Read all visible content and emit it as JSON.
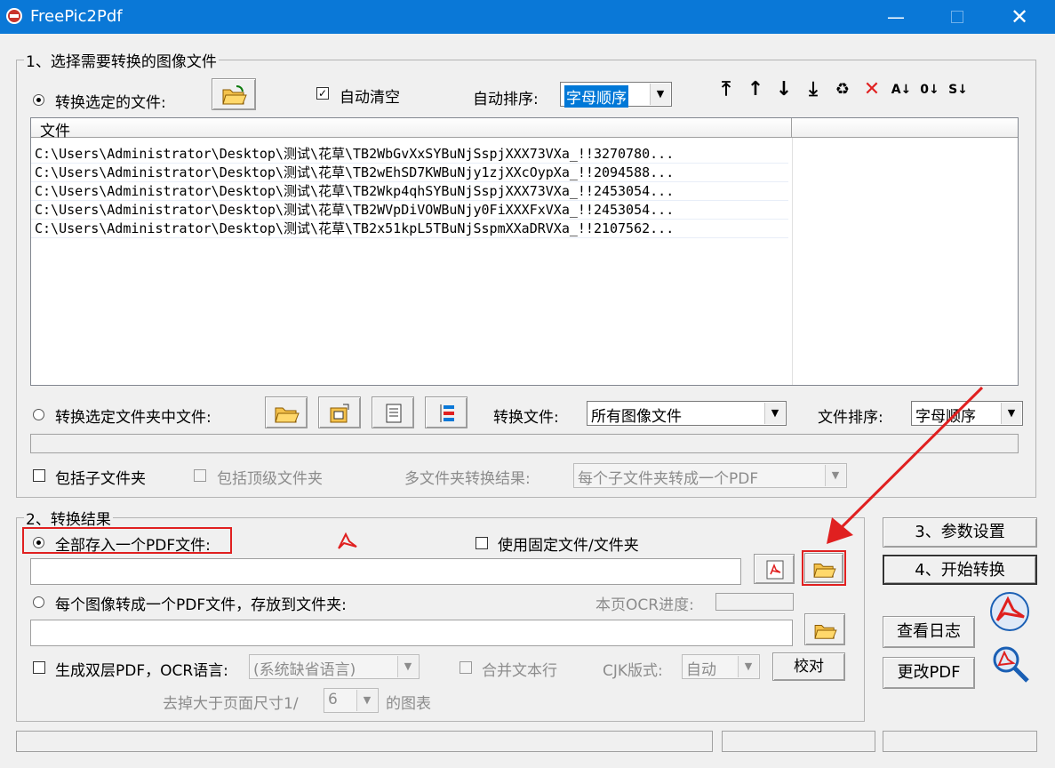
{
  "window": {
    "title": "FreePic2Pdf"
  },
  "section1": {
    "legend": "1、选择需要转换的图像文件",
    "convert_selected_files": "转换选定的文件:",
    "auto_clear": "自动清空",
    "auto_sort_label": "自动排序:",
    "auto_sort_value": "字母顺序",
    "list_header": "文件",
    "files": [
      "C:\\Users\\Administrator\\Desktop\\测试\\花草\\TB2WbGvXxSYBuNjSspjXXX73VXa_!!3270780...",
      "C:\\Users\\Administrator\\Desktop\\测试\\花草\\TB2wEhSD7KWBuNjy1zjXXcOypXa_!!2094588...",
      "C:\\Users\\Administrator\\Desktop\\测试\\花草\\TB2Wkp4qhSYBuNjSspjXXX73VXa_!!2453054...",
      "C:\\Users\\Administrator\\Desktop\\测试\\花草\\TB2WVpDiVOWBuNjy0FiXXXFxVXa_!!2453054...",
      "C:\\Users\\Administrator\\Desktop\\测试\\花草\\TB2x51kpL5TBuNjSspmXXaDRVXa_!!2107562..."
    ],
    "convert_folder_files": "转换选定文件夹中文件:",
    "convert_file_type_label": "转换文件:",
    "convert_file_type_value": "所有图像文件",
    "file_sort_label": "文件排序:",
    "file_sort_value": "字母顺序",
    "include_subfolders": "包括子文件夹",
    "include_top_folder": "包括顶级文件夹",
    "multi_folder_label": "多文件夹转换结果:",
    "multi_folder_value": "每个子文件夹转成一个PDF"
  },
  "section2": {
    "legend": "2、转换结果",
    "all_into_one_pdf": "全部存入一个PDF文件:",
    "use_fixed_folder": "使用固定文件/文件夹",
    "each_image_pdf": "每个图像转成一个PDF文件，存放到文件夹:",
    "ocr_progress_label": "本页OCR进度:",
    "dual_layer_pdf": "生成双层PDF，OCR语言:",
    "ocr_language": "(系统缺省语言)",
    "merge_lines": "合并文本行",
    "cjk_label": "CJK版式:",
    "cjk_value": "自动",
    "proof_button": "校对",
    "remove_larger_label": "去掉大于页面尺寸1/",
    "remove_larger_value": "6",
    "remove_larger_suffix": "的图表"
  },
  "side_buttons": {
    "params": "3、参数设置",
    "start": "4、开始转换",
    "view_log": "查看日志",
    "modify_pdf": "更改PDF"
  },
  "colors": {
    "titlebar": "#0a78d7",
    "highlight": "#e02020",
    "selection": "#0078d7"
  }
}
